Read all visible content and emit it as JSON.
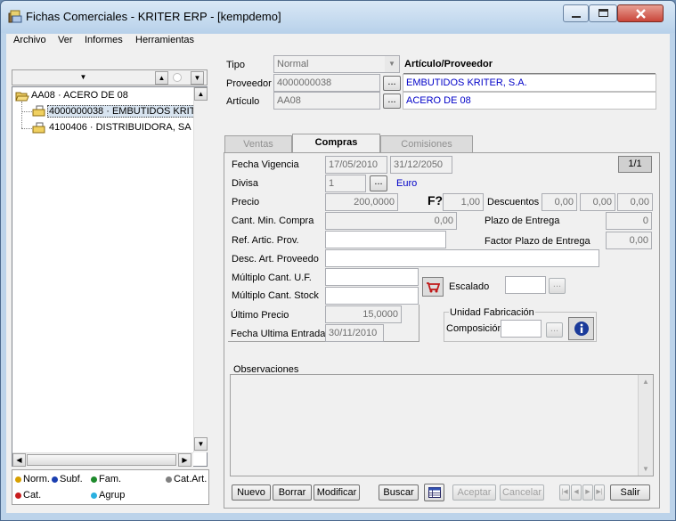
{
  "window": {
    "title": "Fichas Comerciales - KRITER ERP - [kempdemo]"
  },
  "menu": [
    "Archivo",
    "Ver",
    "Informes",
    "Herramientas"
  ],
  "tree": {
    "root": "AA08 · ACERO DE 08",
    "children": [
      "4000000038 · EMBUTIDOS KRIT",
      "4100406 · DISTRIBUIDORA, SA"
    ]
  },
  "legend": {
    "norm": "Norm.",
    "subf": "Subf.",
    "fam": "Fam.",
    "catart": "Cat.Art.",
    "cat": "Cat.",
    "agrup": "Agrup",
    "colors": {
      "norm": "#d8a000",
      "subf": "#1a3fb0",
      "fam": "#1e8a2c",
      "catart": "#808080",
      "cat": "#c81e1e",
      "agrup": "#2ab0e0"
    }
  },
  "header": {
    "tipo_label": "Tipo",
    "tipo_value": "Normal",
    "tipo_right": "Artículo/Proveedor",
    "proveedor_label": "Proveedor",
    "proveedor_value": "4000000038",
    "proveedor_name": "EMBUTIDOS KRITER, S.A.",
    "articulo_label": "Artículo",
    "articulo_value": "AA08",
    "articulo_name": "ACERO DE 08",
    "ellipsis": "..."
  },
  "tabs": [
    "Ventas",
    "Compras",
    "Comisiones"
  ],
  "form": {
    "pager": "1/1",
    "fecha_vigencia_label": "Fecha Vigencia",
    "fecha_desde": "17/05/2010",
    "fecha_hasta": "31/12/2050",
    "divisa_label": "Divisa",
    "divisa_value": "1",
    "divisa_name": "Euro",
    "precio_label": "Precio",
    "precio_value": "200,0000",
    "f_symbol": "F?",
    "f_value": "1,00",
    "descuentos_label": "Descuentos",
    "desc1": "0,00",
    "desc2": "0,00",
    "desc3": "0,00",
    "cant_min_label": "Cant. Min. Compra",
    "cant_min_value": "0,00",
    "plazo_label": "Plazo de Entrega",
    "plazo_value": "0",
    "ref_label": "Ref. Artic. Prov.",
    "factor_label": "Factor Plazo de Entrega",
    "factor_value": "0,00",
    "desc_art_label": "Desc. Art. Proveedo",
    "multiplo_uf_label": "Múltiplo Cant. U.F.",
    "multiplo_stock_label": "Múltiplo Cant. Stock",
    "escalado_label": "Escalado",
    "ultimo_precio_label": "Último Precio",
    "ultimo_precio_value": "15,0000",
    "fecha_ultima_label": "Fecha Ultima Entrada",
    "fecha_ultima_value": "30/11/2010",
    "unidad_fab_label": "Unidad Fabricación",
    "composicion_label": "Composición",
    "observaciones_label": "Observaciones"
  },
  "buttons": {
    "nuevo": "Nuevo",
    "borrar": "Borrar",
    "modificar": "Modificar",
    "buscar": "Buscar",
    "aceptar": "Aceptar",
    "cancelar": "Cancelar",
    "salir": "Salir"
  }
}
